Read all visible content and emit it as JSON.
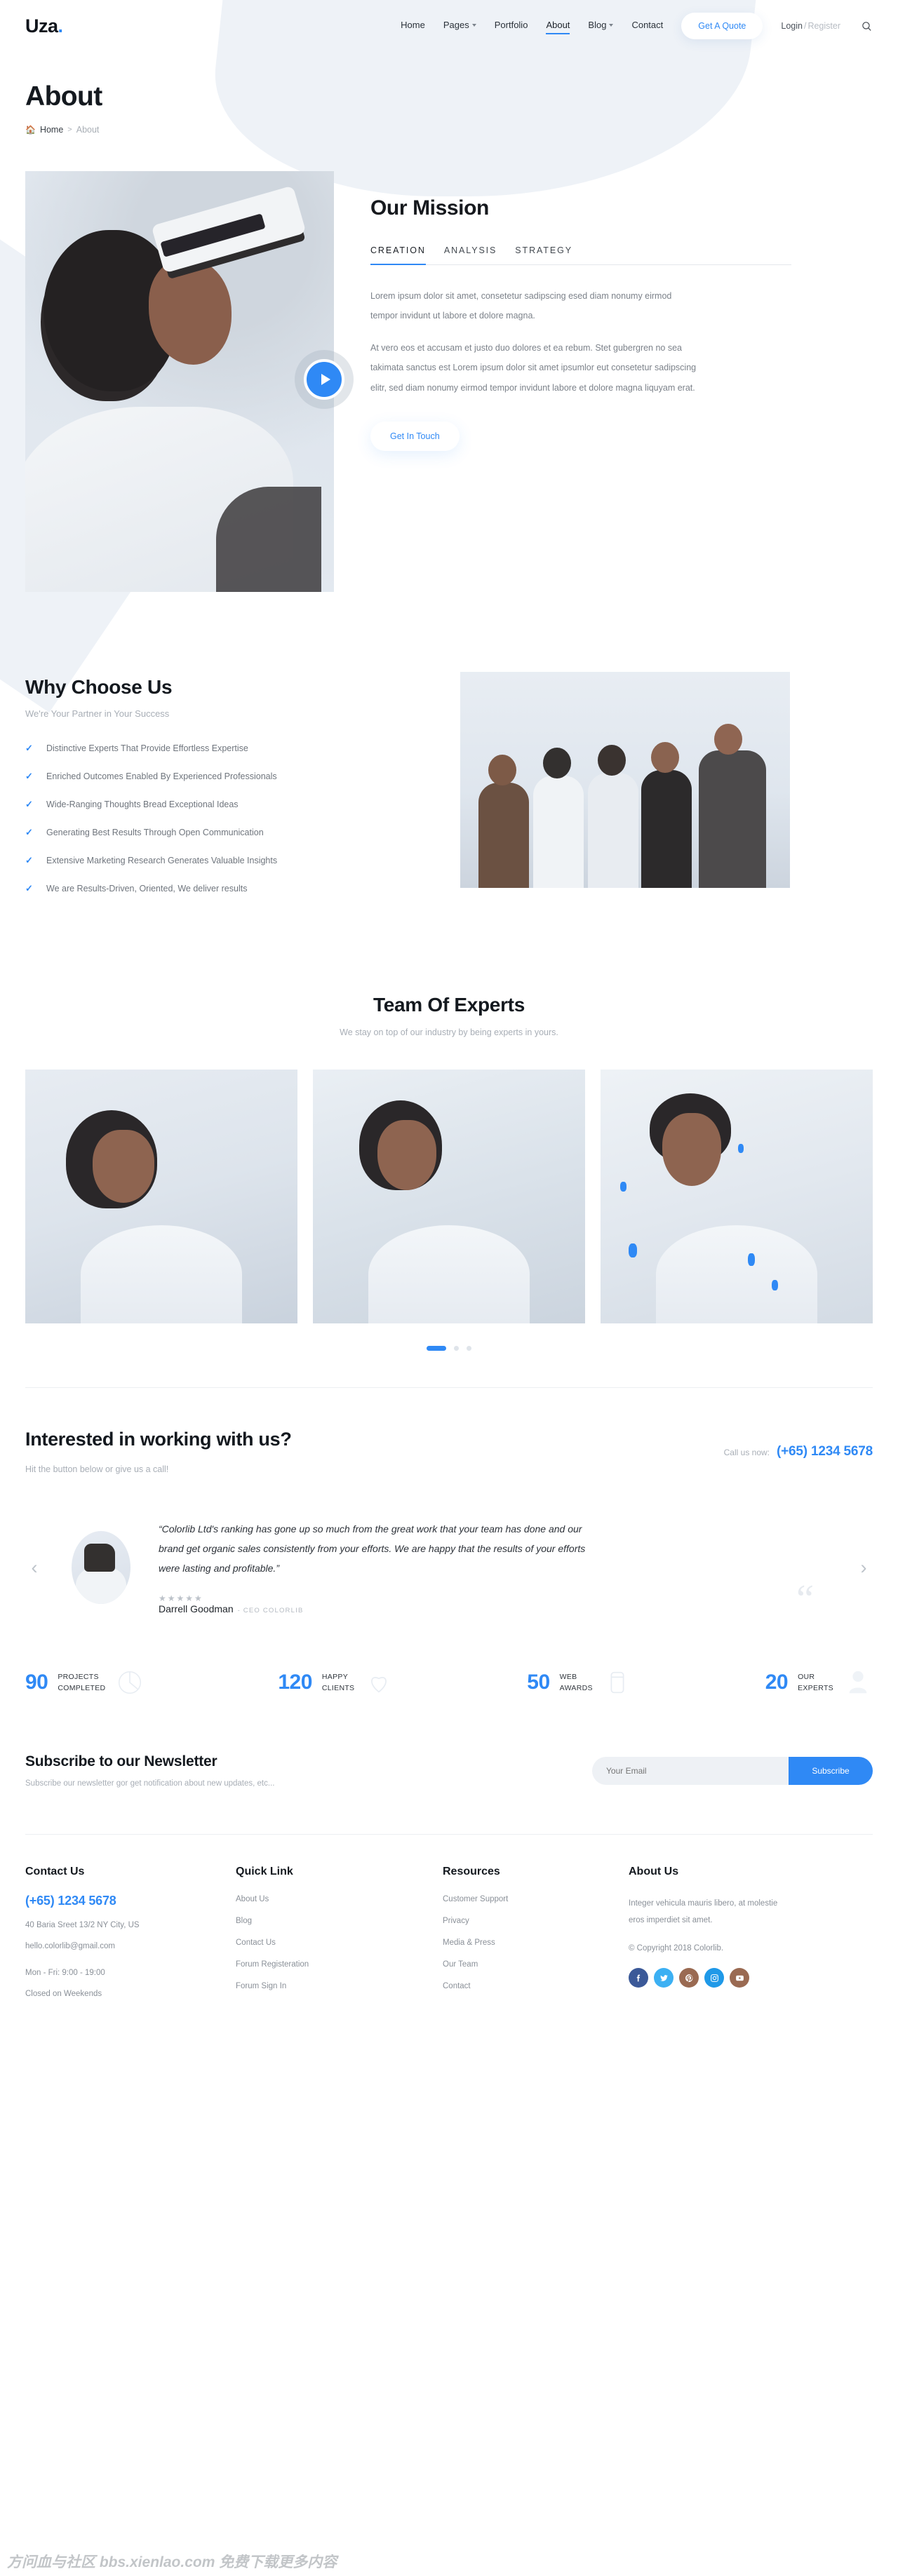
{
  "header": {
    "logo": "Uza",
    "logo_dot": ".",
    "nav": [
      {
        "label": "Home",
        "has_caret": false,
        "active": false
      },
      {
        "label": "Pages",
        "has_caret": true,
        "active": false
      },
      {
        "label": "Portfolio",
        "has_caret": false,
        "active": false
      },
      {
        "label": "About",
        "has_caret": false,
        "active": true
      },
      {
        "label": "Blog",
        "has_caret": true,
        "active": false
      },
      {
        "label": "Contact",
        "has_caret": false,
        "active": false
      }
    ],
    "quote_button": "Get A Quote",
    "login": "Login",
    "login_sep": "/",
    "register": "Register",
    "search_icon": "search-icon"
  },
  "page": {
    "title": "About",
    "breadcrumb_home": "Home",
    "breadcrumb_sep": ">",
    "breadcrumb_current": "About"
  },
  "mission": {
    "title": "Our Mission",
    "tabs": [
      {
        "label": "CREATION",
        "active": true
      },
      {
        "label": "ANALYSIS",
        "active": false
      },
      {
        "label": "STRATEGY",
        "active": false
      }
    ],
    "paragraph1": "Lorem ipsum dolor sit amet, consetetur sadipscing esed diam nonumy eirmod tempor invidunt ut labore et dolore magna.",
    "paragraph2": "At vero eos et accusam et justo duo dolores et ea rebum. Stet gubergren no sea takimata sanctus est Lorem ipsum dolor sit amet ipsumlor eut consetetur sadipscing elitr, sed diam nonumy eirmod tempor invidunt labore et dolore magna liquyam erat.",
    "button": "Get In Touch",
    "play_icon": "play-icon"
  },
  "why": {
    "title": "Why Choose Us",
    "subtitle": "We're Your Partner in Your Success",
    "items": [
      "Distinctive Experts That Provide Effortless Expertise",
      "Enriched Outcomes Enabled By Experienced Professionals",
      "Wide-Ranging Thoughts Bread Exceptional Ideas",
      "Generating Best Results Through Open Communication",
      "Extensive Marketing Research Generates Valuable Insights",
      "We are Results-Driven, Oriented, We deliver results"
    ]
  },
  "team": {
    "title": "Team Of Experts",
    "subtitle": "We stay on top of our industry by being experts in yours.",
    "slides": [
      {
        "name": "team-member-1"
      },
      {
        "name": "team-member-2"
      },
      {
        "name": "team-member-3"
      }
    ],
    "dots": [
      {
        "active": true
      },
      {
        "active": false
      },
      {
        "active": false
      }
    ]
  },
  "cta": {
    "title": "Interested in working with us?",
    "subtitle": "Hit the button below or give us a call!",
    "call_label": "Call us now:",
    "call_number": "(+65) 1234 5678"
  },
  "testimonial": {
    "prev_icon": "chevron-left-icon",
    "next_icon": "chevron-right-icon",
    "quote": "“Colorlib Ltd's ranking has gone up so much from the great work that your team has done and our brand get organic sales consistently from your efforts. We are happy that the results of your efforts were lasting and profitable.”",
    "stars": "★★★★★",
    "author": "Darrell Goodman",
    "role": "- CEO COLORLIB",
    "quote_mark": "“"
  },
  "counters": [
    {
      "number": "90",
      "label_line1": "PROJECTS",
      "label_line2": "COMPLETED",
      "icon": "pie-chart-icon"
    },
    {
      "number": "120",
      "label_line1": "HAPPY",
      "label_line2": "CLIENTS",
      "icon": "heart-icon"
    },
    {
      "number": "50",
      "label_line1": "WEB",
      "label_line2": "AWARDS",
      "icon": "trophy-icon"
    },
    {
      "number": "20",
      "label_line1": "OUR",
      "label_line2": "EXPERTS",
      "icon": "person-icon"
    }
  ],
  "newsletter": {
    "title": "Subscribe to our Newsletter",
    "subtitle": "Subscribe our newsletter gor get notification about new updates, etc...",
    "placeholder": "Your Email",
    "button": "Subscribe"
  },
  "footer": {
    "contact": {
      "title": "Contact Us",
      "phone": "(+65) 1234 5678",
      "address": "40 Baria Sreet 13/2 NY City, US",
      "email": "hello.colorlib@gmail.com",
      "hours1": "Mon - Fri: 9:00 - 19:00",
      "hours2": "Closed on Weekends"
    },
    "quick": {
      "title": "Quick Link",
      "links": [
        "About Us",
        "Blog",
        "Contact Us",
        "Forum Registeration",
        "Forum Sign In"
      ]
    },
    "resources": {
      "title": "Resources",
      "links": [
        "Customer Support",
        "Privacy",
        "Media & Press",
        "Our Team",
        "Contact"
      ]
    },
    "about": {
      "title": "About Us",
      "text": "Integer vehicula mauris libero, at molestie eros imperdiet sit amet.",
      "copyright": "© Copyright 2018 Colorlib.",
      "socials": [
        {
          "name": "facebook-icon",
          "color": "#3b5998"
        },
        {
          "name": "twitter-icon",
          "color": "#3cb0f3"
        },
        {
          "name": "pinterest-icon",
          "color": "#9a6a52"
        },
        {
          "name": "instagram-icon",
          "color": "#1f99e8"
        },
        {
          "name": "youtube-icon",
          "color": "#9a6a52"
        }
      ]
    }
  },
  "watermark": "方问血与社区 bbs.xienlao.com 免费下载更多内容",
  "colors": {
    "accent": "#2f89f5",
    "dark": "#14191f",
    "muted": "#8a9098",
    "surface": "#eef2f7"
  }
}
